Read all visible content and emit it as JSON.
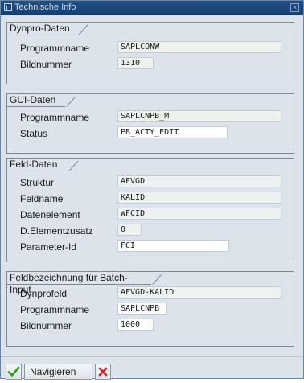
{
  "window": {
    "title": "Technische Info"
  },
  "groups": {
    "dynpro": {
      "title": "Dynpro-Daten",
      "rows": [
        {
          "label": "Programmname",
          "value": "SAPLCONW"
        },
        {
          "label": "Bildnummer",
          "value": "1310"
        }
      ]
    },
    "gui": {
      "title": "GUI-Daten",
      "rows": [
        {
          "label": "Programmname",
          "value": "SAPLCNPB_M"
        },
        {
          "label": "Status",
          "value": "PB_ACTY_EDIT"
        }
      ]
    },
    "feld": {
      "title": "Feld-Daten",
      "rows": [
        {
          "label": "Struktur",
          "value": "AFVGD"
        },
        {
          "label": "Feldname",
          "value": "KALID"
        },
        {
          "label": "Datenelement",
          "value": "WFCID"
        },
        {
          "label": "D.Elementzusatz",
          "value": "0"
        },
        {
          "label": "Parameter-Id",
          "value": "FCI"
        }
      ]
    },
    "batch": {
      "title": "Feldbezeichnung für Batch-Input",
      "rows": [
        {
          "label": "Dynprofeld",
          "value": "AFVGD-KALID"
        },
        {
          "label": "Programmname",
          "value": "SAPLCNPB"
        },
        {
          "label": "Bildnummer",
          "value": "1000"
        }
      ]
    }
  },
  "toolbar": {
    "navigate_label": "Navigieren",
    "confirm_icon": "checkmark-icon",
    "cancel_icon": "cancel-x-icon"
  },
  "colors": {
    "titlebar": "#1f4f88",
    "background": "#dde3ea",
    "confirm": "#2f9a1f",
    "cancel": "#d42020"
  }
}
